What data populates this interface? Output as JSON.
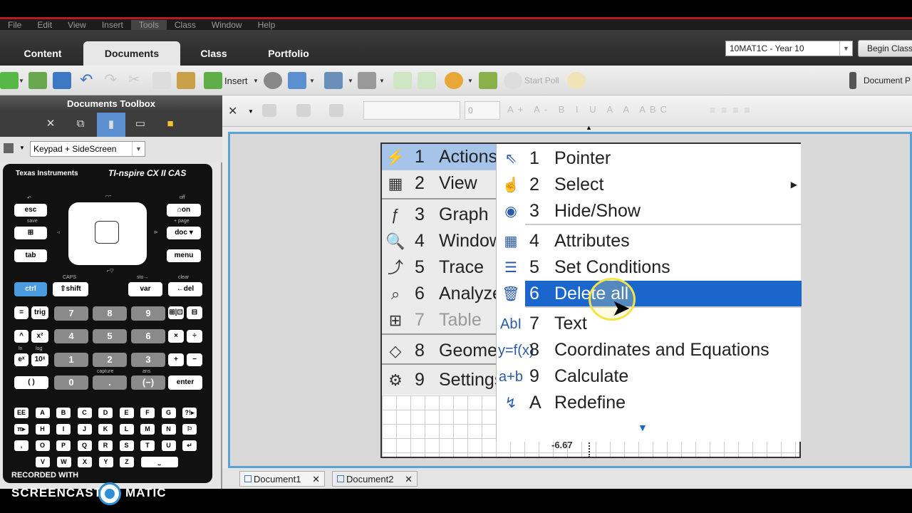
{
  "menu_bar": [
    "File",
    "Edit",
    "View",
    "Insert",
    "Tools",
    "Class",
    "Window",
    "Help"
  ],
  "tabs": [
    "Content",
    "Documents",
    "Class",
    "Portfolio"
  ],
  "active_tab": "Documents",
  "class_select": {
    "value": "10MAT1C - Year 10"
  },
  "begin_class": "Begin Class",
  "toolbar": {
    "insert_label": "Insert",
    "start_poll": "Start Poll",
    "document_label": "Document P"
  },
  "toolbox": {
    "title": "Documents Toolbox",
    "keypad_select": "Keypad + SideScreen"
  },
  "handheld": {
    "brand": "Texas Instruments",
    "model": "TI-nspire CX II CAS",
    "keys": {
      "esc": "esc",
      "on": "⌂on",
      "scratch": "⊞",
      "doc": "doc ▾",
      "tab": "tab",
      "menu": "menu",
      "ctrl": "ctrl",
      "shift": "⇧shift",
      "var": "var",
      "del": "←del",
      "eq": "=",
      "trig": "trig",
      "caret": "^",
      "x2": "x²",
      "ex": "eˣ",
      "tenx": "10ˣ",
      "paren": "( )",
      "templ": "⊞|⊡",
      "frac": "⊟",
      "times": "×",
      "div": "÷",
      "plus": "+",
      "minus": "−",
      "enter": "enter",
      "neg": "(−)",
      "dot": ".",
      "n7": "7",
      "n8": "8",
      "n9": "9",
      "n4": "4",
      "n5": "5",
      "n6": "6",
      "n1": "1",
      "n2": "2",
      "n3": "3",
      "n0": "0"
    },
    "sublabels": {
      "save": "save",
      "caps": "CAPS",
      "sto": "sto→",
      "clear": "clear",
      "off": "off",
      "page": "+ page",
      "capture": "capture",
      "ans": "ans",
      "ln": "ln",
      "log": "log"
    },
    "alpha_rows": [
      [
        "EE",
        "A",
        "B",
        "C",
        "D",
        "E",
        "F",
        "G",
        "?!▸"
      ],
      [
        "π▸",
        "H",
        "I",
        "J",
        "K",
        "L",
        "M",
        "N",
        "⚐"
      ],
      [
        ",",
        "O",
        "P",
        "Q",
        "R",
        "S",
        "T",
        "U",
        "↵"
      ],
      [
        "V",
        "W",
        "X",
        "Y",
        "Z",
        "⎵"
      ]
    ]
  },
  "main_menu": [
    {
      "num": "1",
      "label": "Actions",
      "icon": "⚡"
    },
    {
      "num": "2",
      "label": "View",
      "icon": "▦"
    },
    {
      "num": "3",
      "label": "Graph",
      "icon": "ƒ"
    },
    {
      "num": "4",
      "label": "Window",
      "icon": "🔍"
    },
    {
      "num": "5",
      "label": "Trace",
      "icon": "⤴"
    },
    {
      "num": "6",
      "label": "Analyze",
      "icon": "⌕"
    },
    {
      "num": "7",
      "label": "Table",
      "icon": "⊞"
    },
    {
      "num": "8",
      "label": "Geome",
      "icon": "◇"
    },
    {
      "num": "9",
      "label": "Settings",
      "icon": "⚙"
    }
  ],
  "sub_menu": [
    {
      "num": "1",
      "label": "Pointer",
      "icon": "⇖"
    },
    {
      "num": "2",
      "label": "Select",
      "icon": "☝"
    },
    {
      "num": "3",
      "label": "Hide/Show",
      "icon": "◉"
    },
    {
      "num": "4",
      "label": "Attributes",
      "icon": "▦"
    },
    {
      "num": "5",
      "label": "Set Conditions",
      "icon": "☰"
    },
    {
      "num": "6",
      "label": "Delete all",
      "icon": "🗑"
    },
    {
      "num": "7",
      "label": "Text",
      "icon": "AbI"
    },
    {
      "num": "8",
      "label": "Coordinates and Equations",
      "icon": "y=f(x)"
    },
    {
      "num": "9",
      "label": "Calculate",
      "icon": "a+b"
    },
    {
      "num": "A",
      "label": "Redefine",
      "icon": "↯"
    }
  ],
  "graph_label": "-6.67",
  "font_size_value": "0",
  "doc_tabs": [
    "Document1",
    "Document2"
  ],
  "watermark": {
    "line1": "RECORDED WITH",
    "line2a": "SCREENCAST",
    "line2b": "MATIC"
  },
  "colors": {
    "highlight": "#1a66cc",
    "workspace_border": "#5ba3d6",
    "menu_highlight": "#a6c4ea"
  }
}
